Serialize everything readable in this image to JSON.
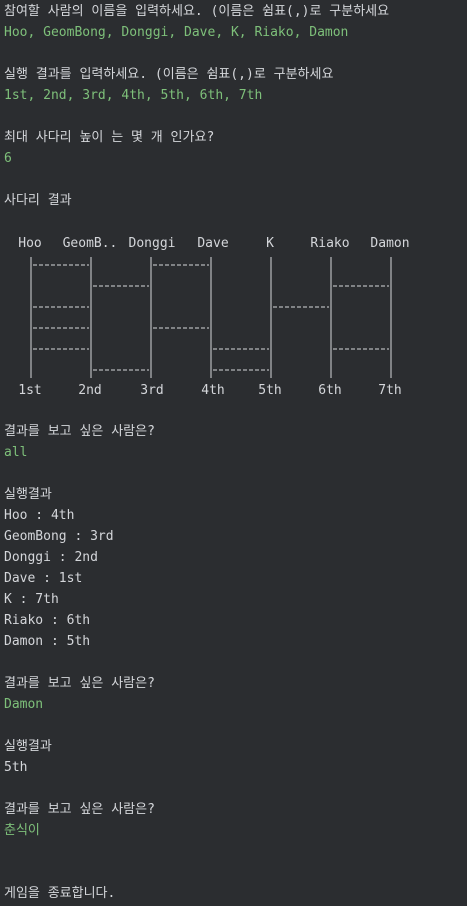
{
  "prompts": {
    "names_prompt": "참여할 사람의 이름을 입력하세요. (이름은 쉼표(,)로 구분하세요",
    "names_input": "Hoo, GeomBong, Donggi, Dave, K, Riako, Damon",
    "results_prompt": "실행 결과를 입력하세요. (이름은 쉼표(,)로 구분하세요",
    "results_input": "1st, 2nd, 3rd, 4th, 5th, 6th, 7th",
    "height_prompt": "최대 사다리 높이 는 몇 개 인가요?",
    "height_input": "6"
  },
  "ladder": {
    "title": "사다리 결과",
    "players": [
      "Hoo",
      "GeomB..",
      "Donggi",
      "Dave",
      "K",
      "Riako",
      "Damon"
    ],
    "results": [
      "1st",
      "2nd",
      "3rd",
      "4th",
      "5th",
      "6th",
      "7th"
    ],
    "rows": [
      [
        true,
        false,
        true,
        false,
        false,
        false
      ],
      [
        false,
        true,
        false,
        false,
        false,
        true
      ],
      [
        true,
        false,
        false,
        false,
        true,
        false
      ],
      [
        true,
        false,
        true,
        false,
        false,
        false
      ],
      [
        true,
        false,
        false,
        true,
        false,
        true
      ],
      [
        false,
        true,
        false,
        true,
        false,
        false
      ]
    ]
  },
  "query1": {
    "prompt": "결과를 보고 싶은 사람은?",
    "input": "all",
    "header": "실행결과",
    "lines": [
      "Hoo : 4th",
      "GeomBong : 3rd",
      "Donggi : 2nd",
      "Dave : 1st",
      "K : 7th",
      "Riako : 6th",
      "Damon : 5th"
    ]
  },
  "query2": {
    "prompt": "결과를 보고 싶은 사람은?",
    "input": "Damon",
    "header": "실행결과",
    "result": "5th"
  },
  "query3": {
    "prompt": "결과를 보고 싶은 사람은?",
    "input": "춘식이"
  },
  "exit_message": "게임을 종료합니다."
}
